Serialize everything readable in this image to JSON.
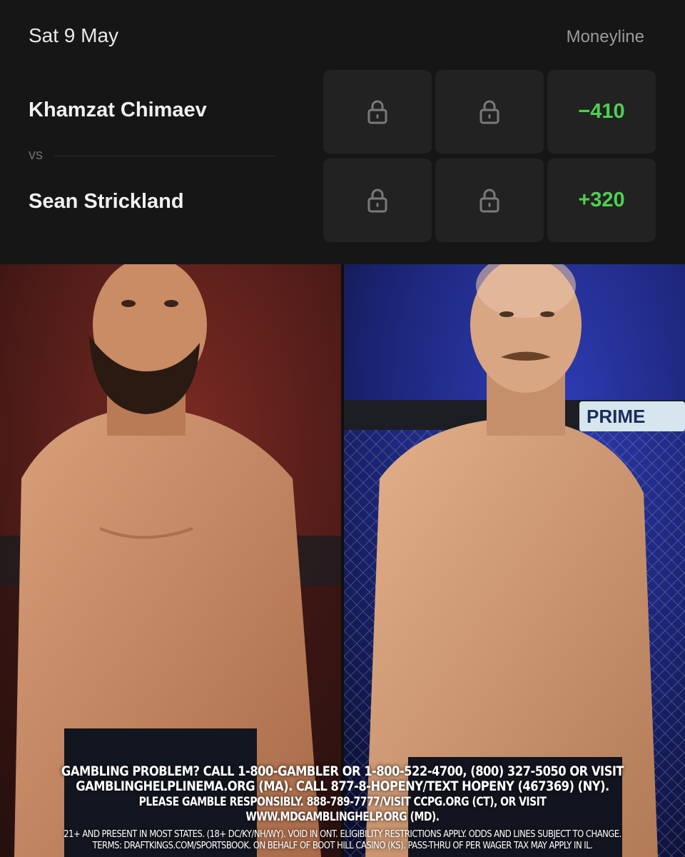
{
  "header": {
    "date": "Sat 9 May",
    "market": "Moneyline"
  },
  "matchup": {
    "fighter_a": {
      "name": "Khamzat Chimaev",
      "moneyline": "−410"
    },
    "vs_label": "vs",
    "fighter_b": {
      "name": "Sean Strickland",
      "moneyline": "+320"
    }
  },
  "cage_banner": {
    "text": "PRIME"
  },
  "disclaimer": {
    "line1": "GAMBLING PROBLEM? CALL 1-800-GAMBLER OR 1-800-522-4700, (800) 327-5050 OR VISIT",
    "line2": "GAMBLINGHELPLINEMA.ORG (MA). CALL 877-8-HOPENY/TEXT HOPENY (467369) (NY).",
    "line3": "PLEASE GAMBLE RESPONSIBLY. 888-789-7777/VISIT CCPG.ORG (CT), OR VISIT WWW.MDGAMBLINGHELP.ORG (MD).",
    "line4": "21+ AND PRESENT IN MOST STATES. (18+ DC/KY/NH/WY). VOID IN ONT. ELIGIBILITY RESTRICTIONS APPLY. ODDS AND LINES SUBJECT TO CHANGE.",
    "line5": "TERMS: DRAFTKINGS.COM/SPORTSBOOK. ON BEHALF OF BOOT HILL CASINO (KS). PASS-THRU OF PER WAGER TAX MAY APPLY IN IL."
  },
  "colors": {
    "panel_bg": "#161616",
    "cell_bg": "#222222",
    "odds_green": "#4fcf52",
    "lock_gray": "#7a7a7a"
  },
  "icons": {
    "locked_market": "lock-icon"
  }
}
